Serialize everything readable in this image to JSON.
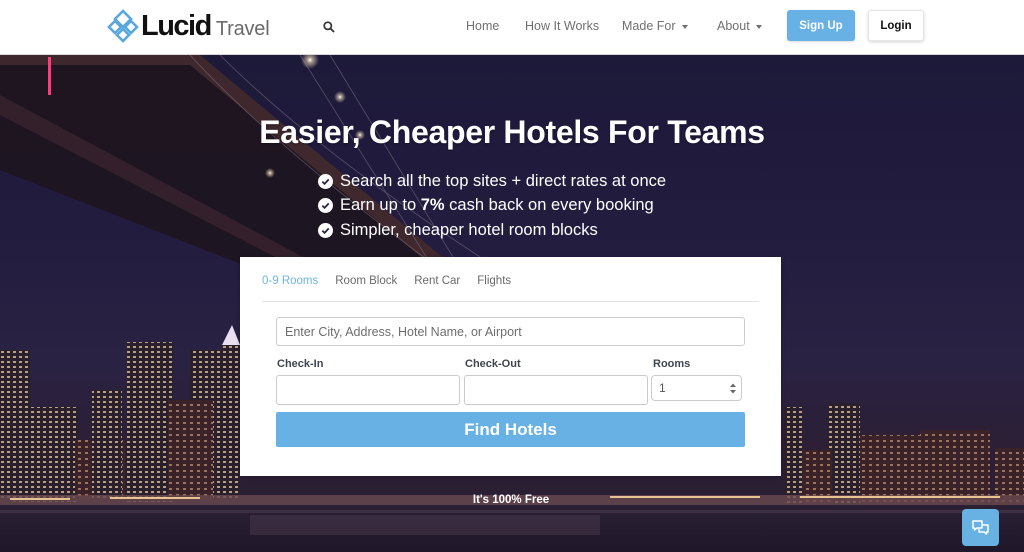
{
  "brand": {
    "name": "Lucid",
    "suffix": "Travel",
    "accent_color": "#67b1e4"
  },
  "navbar": {
    "search_icon": "search-icon",
    "links": [
      {
        "label": "Home",
        "has_dropdown": false
      },
      {
        "label": "How It Works",
        "has_dropdown": false
      },
      {
        "label": "Made For",
        "has_dropdown": true
      },
      {
        "label": "About",
        "has_dropdown": true
      }
    ],
    "signup_label": "Sign Up",
    "login_label": "Login"
  },
  "hero": {
    "headline": "Easier, Cheaper Hotels For Teams",
    "benefits": [
      {
        "before": "Search all the top sites + direct rates at once",
        "bold": "",
        "after": ""
      },
      {
        "before": "Earn up to ",
        "bold": "7%",
        "after": " cash back on every booking"
      },
      {
        "before": "Simpler, cheaper hotel room blocks",
        "bold": "",
        "after": ""
      }
    ],
    "check_icon": "check-circle-icon"
  },
  "search_card": {
    "tabs": [
      {
        "label": "0-9 Rooms",
        "active": true
      },
      {
        "label": "Room Block",
        "active": false
      },
      {
        "label": "Rent Car",
        "active": false
      },
      {
        "label": "Flights",
        "active": false
      }
    ],
    "destination": {
      "placeholder": "Enter City, Address, Hotel Name, or Airport",
      "value": ""
    },
    "check_in": {
      "label": "Check-In",
      "value": ""
    },
    "check_out": {
      "label": "Check-Out",
      "value": ""
    },
    "rooms": {
      "label": "Rooms",
      "selected": "1"
    },
    "submit_label": "Find Hotels"
  },
  "footer_note": "It's 100% Free",
  "chat_widget": {
    "icon": "chat-bubbles-icon"
  }
}
